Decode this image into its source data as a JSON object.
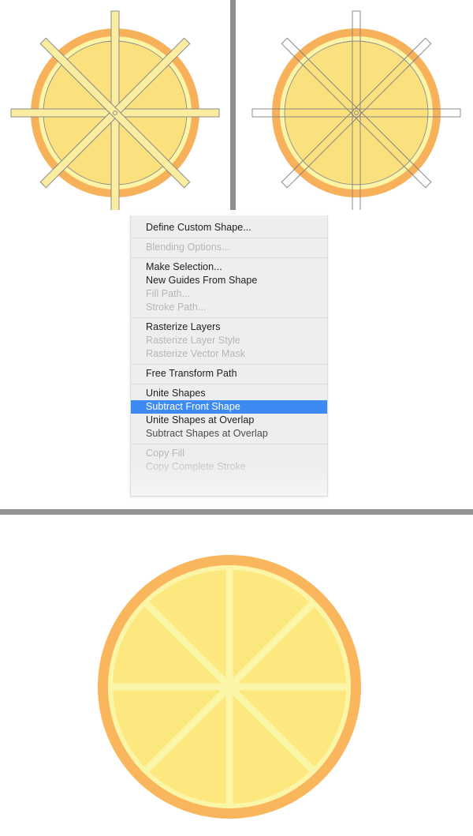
{
  "figures": {
    "left": {
      "name": "Shape with filled divider bars",
      "outer_ring_color": "#f7b15a",
      "pith_color": "#fdf5a6",
      "flesh_color": "#fbe07e",
      "bar_fill_color": "#fbeda0",
      "bar_stroke_color": "#7f7f84",
      "bar_count": 4,
      "bar_angles_deg": [
        0,
        45,
        90,
        135
      ]
    },
    "right": {
      "name": "Shape with unfilled (path only) divider bars",
      "outer_ring_color": "#f7b15a",
      "pith_color": "#fdf5a6",
      "flesh_color": "#fbe07e",
      "bar_fill_color": "none",
      "bar_stroke_color": "#7f7f84",
      "bar_count": 4,
      "bar_angles_deg": [
        0,
        45,
        90,
        135
      ]
    },
    "result": {
      "name": "Finished lemon slice after Subtract Front Shape",
      "rind_color": "#f9b65c",
      "pith_color": "#fbf5a7",
      "segment_color": "#fde87f",
      "segment_count": 8
    }
  },
  "dividers": {
    "vertical_color": "#8e8e8e",
    "horizontal_color": "#949494"
  },
  "context_menu": {
    "background_color": "#eeeeee",
    "selection_color": "#3d8bf2",
    "groups": [
      {
        "items": [
          {
            "label": "Define Custom Shape...",
            "state": "enabled"
          }
        ]
      },
      {
        "items": [
          {
            "label": "Blending Options...",
            "state": "disabled"
          }
        ]
      },
      {
        "items": [
          {
            "label": "Make Selection...",
            "state": "enabled"
          },
          {
            "label": "New Guides From Shape",
            "state": "enabled"
          },
          {
            "label": "Fill Path...",
            "state": "disabled"
          },
          {
            "label": "Stroke Path...",
            "state": "disabled"
          }
        ]
      },
      {
        "items": [
          {
            "label": "Rasterize Layers",
            "state": "enabled"
          },
          {
            "label": "Rasterize Layer Style",
            "state": "disabled"
          },
          {
            "label": "Rasterize Vector Mask",
            "state": "disabled"
          }
        ]
      },
      {
        "items": [
          {
            "label": "Free Transform Path",
            "state": "enabled"
          }
        ]
      },
      {
        "items": [
          {
            "label": "Unite Shapes",
            "state": "enabled"
          },
          {
            "label": "Subtract Front Shape",
            "state": "selected"
          },
          {
            "label": "Unite Shapes at Overlap",
            "state": "enabled"
          },
          {
            "label": "Subtract Shapes at Overlap",
            "state": "medium"
          }
        ]
      },
      {
        "items": [
          {
            "label": "Copy Fill",
            "state": "disabled"
          },
          {
            "label": "Copy Complete Stroke",
            "state": "disabled"
          }
        ]
      }
    ]
  }
}
